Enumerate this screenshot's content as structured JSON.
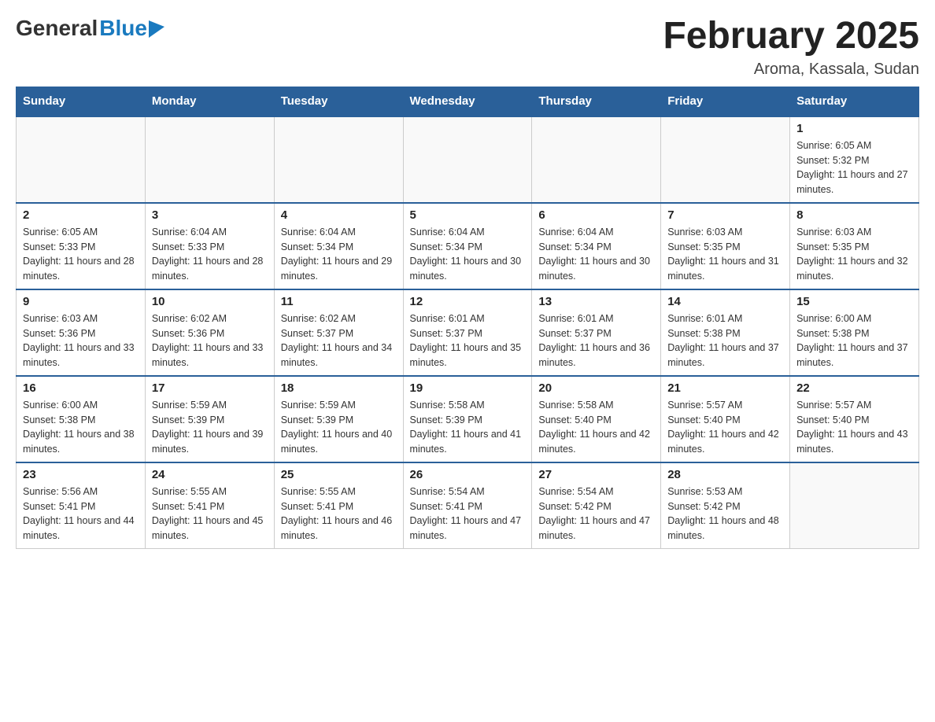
{
  "header": {
    "logo_general": "General",
    "logo_blue": "Blue",
    "month_title": "February 2025",
    "location": "Aroma, Kassala, Sudan"
  },
  "weekdays": [
    "Sunday",
    "Monday",
    "Tuesday",
    "Wednesday",
    "Thursday",
    "Friday",
    "Saturday"
  ],
  "weeks": [
    [
      {
        "day": "",
        "sunrise": "",
        "sunset": "",
        "daylight": ""
      },
      {
        "day": "",
        "sunrise": "",
        "sunset": "",
        "daylight": ""
      },
      {
        "day": "",
        "sunrise": "",
        "sunset": "",
        "daylight": ""
      },
      {
        "day": "",
        "sunrise": "",
        "sunset": "",
        "daylight": ""
      },
      {
        "day": "",
        "sunrise": "",
        "sunset": "",
        "daylight": ""
      },
      {
        "day": "",
        "sunrise": "",
        "sunset": "",
        "daylight": ""
      },
      {
        "day": "1",
        "sunrise": "Sunrise: 6:05 AM",
        "sunset": "Sunset: 5:32 PM",
        "daylight": "Daylight: 11 hours and 27 minutes."
      }
    ],
    [
      {
        "day": "2",
        "sunrise": "Sunrise: 6:05 AM",
        "sunset": "Sunset: 5:33 PM",
        "daylight": "Daylight: 11 hours and 28 minutes."
      },
      {
        "day": "3",
        "sunrise": "Sunrise: 6:04 AM",
        "sunset": "Sunset: 5:33 PM",
        "daylight": "Daylight: 11 hours and 28 minutes."
      },
      {
        "day": "4",
        "sunrise": "Sunrise: 6:04 AM",
        "sunset": "Sunset: 5:34 PM",
        "daylight": "Daylight: 11 hours and 29 minutes."
      },
      {
        "day": "5",
        "sunrise": "Sunrise: 6:04 AM",
        "sunset": "Sunset: 5:34 PM",
        "daylight": "Daylight: 11 hours and 30 minutes."
      },
      {
        "day": "6",
        "sunrise": "Sunrise: 6:04 AM",
        "sunset": "Sunset: 5:34 PM",
        "daylight": "Daylight: 11 hours and 30 minutes."
      },
      {
        "day": "7",
        "sunrise": "Sunrise: 6:03 AM",
        "sunset": "Sunset: 5:35 PM",
        "daylight": "Daylight: 11 hours and 31 minutes."
      },
      {
        "day": "8",
        "sunrise": "Sunrise: 6:03 AM",
        "sunset": "Sunset: 5:35 PM",
        "daylight": "Daylight: 11 hours and 32 minutes."
      }
    ],
    [
      {
        "day": "9",
        "sunrise": "Sunrise: 6:03 AM",
        "sunset": "Sunset: 5:36 PM",
        "daylight": "Daylight: 11 hours and 33 minutes."
      },
      {
        "day": "10",
        "sunrise": "Sunrise: 6:02 AM",
        "sunset": "Sunset: 5:36 PM",
        "daylight": "Daylight: 11 hours and 33 minutes."
      },
      {
        "day": "11",
        "sunrise": "Sunrise: 6:02 AM",
        "sunset": "Sunset: 5:37 PM",
        "daylight": "Daylight: 11 hours and 34 minutes."
      },
      {
        "day": "12",
        "sunrise": "Sunrise: 6:01 AM",
        "sunset": "Sunset: 5:37 PM",
        "daylight": "Daylight: 11 hours and 35 minutes."
      },
      {
        "day": "13",
        "sunrise": "Sunrise: 6:01 AM",
        "sunset": "Sunset: 5:37 PM",
        "daylight": "Daylight: 11 hours and 36 minutes."
      },
      {
        "day": "14",
        "sunrise": "Sunrise: 6:01 AM",
        "sunset": "Sunset: 5:38 PM",
        "daylight": "Daylight: 11 hours and 37 minutes."
      },
      {
        "day": "15",
        "sunrise": "Sunrise: 6:00 AM",
        "sunset": "Sunset: 5:38 PM",
        "daylight": "Daylight: 11 hours and 37 minutes."
      }
    ],
    [
      {
        "day": "16",
        "sunrise": "Sunrise: 6:00 AM",
        "sunset": "Sunset: 5:38 PM",
        "daylight": "Daylight: 11 hours and 38 minutes."
      },
      {
        "day": "17",
        "sunrise": "Sunrise: 5:59 AM",
        "sunset": "Sunset: 5:39 PM",
        "daylight": "Daylight: 11 hours and 39 minutes."
      },
      {
        "day": "18",
        "sunrise": "Sunrise: 5:59 AM",
        "sunset": "Sunset: 5:39 PM",
        "daylight": "Daylight: 11 hours and 40 minutes."
      },
      {
        "day": "19",
        "sunrise": "Sunrise: 5:58 AM",
        "sunset": "Sunset: 5:39 PM",
        "daylight": "Daylight: 11 hours and 41 minutes."
      },
      {
        "day": "20",
        "sunrise": "Sunrise: 5:58 AM",
        "sunset": "Sunset: 5:40 PM",
        "daylight": "Daylight: 11 hours and 42 minutes."
      },
      {
        "day": "21",
        "sunrise": "Sunrise: 5:57 AM",
        "sunset": "Sunset: 5:40 PM",
        "daylight": "Daylight: 11 hours and 42 minutes."
      },
      {
        "day": "22",
        "sunrise": "Sunrise: 5:57 AM",
        "sunset": "Sunset: 5:40 PM",
        "daylight": "Daylight: 11 hours and 43 minutes."
      }
    ],
    [
      {
        "day": "23",
        "sunrise": "Sunrise: 5:56 AM",
        "sunset": "Sunset: 5:41 PM",
        "daylight": "Daylight: 11 hours and 44 minutes."
      },
      {
        "day": "24",
        "sunrise": "Sunrise: 5:55 AM",
        "sunset": "Sunset: 5:41 PM",
        "daylight": "Daylight: 11 hours and 45 minutes."
      },
      {
        "day": "25",
        "sunrise": "Sunrise: 5:55 AM",
        "sunset": "Sunset: 5:41 PM",
        "daylight": "Daylight: 11 hours and 46 minutes."
      },
      {
        "day": "26",
        "sunrise": "Sunrise: 5:54 AM",
        "sunset": "Sunset: 5:41 PM",
        "daylight": "Daylight: 11 hours and 47 minutes."
      },
      {
        "day": "27",
        "sunrise": "Sunrise: 5:54 AM",
        "sunset": "Sunset: 5:42 PM",
        "daylight": "Daylight: 11 hours and 47 minutes."
      },
      {
        "day": "28",
        "sunrise": "Sunrise: 5:53 AM",
        "sunset": "Sunset: 5:42 PM",
        "daylight": "Daylight: 11 hours and 48 minutes."
      },
      {
        "day": "",
        "sunrise": "",
        "sunset": "",
        "daylight": ""
      }
    ]
  ]
}
